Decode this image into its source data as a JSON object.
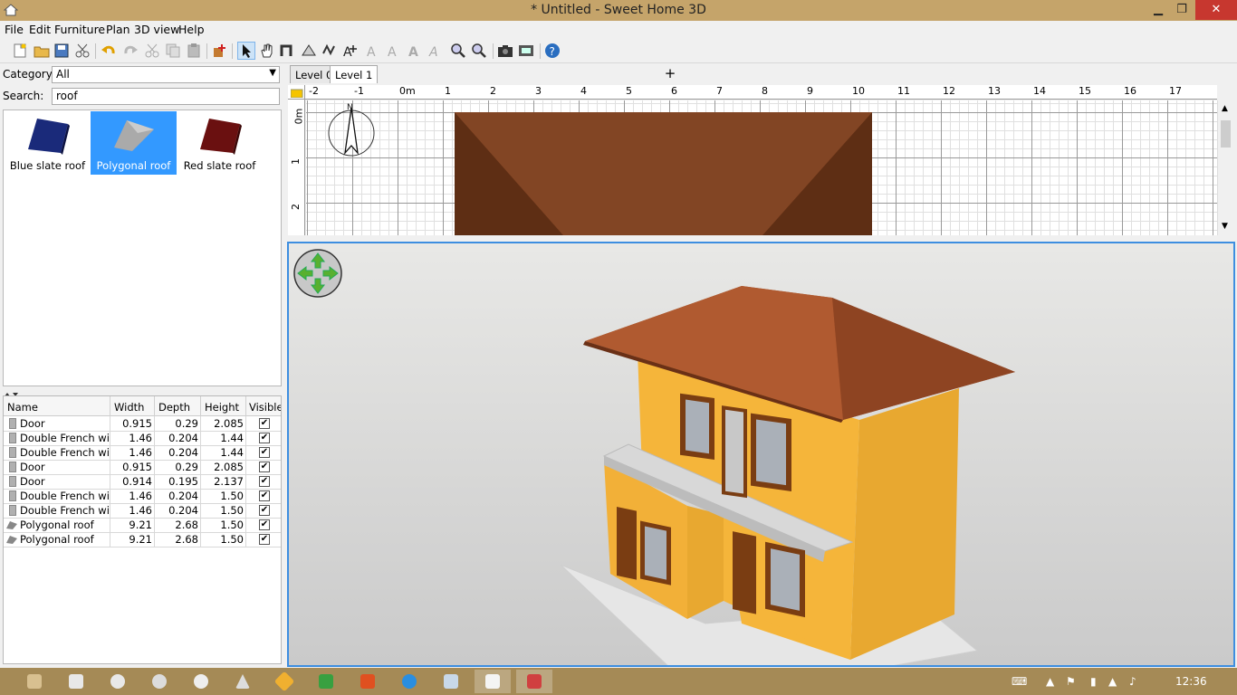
{
  "window": {
    "title": "* Untitled - Sweet Home 3D",
    "min": "▁",
    "max": "❐",
    "close": "✕"
  },
  "menu": [
    "File",
    "Edit",
    "Furniture",
    "Plan",
    "3D view",
    "Help"
  ],
  "toolbar": {
    "icons": [
      "new-home-icon",
      "open-icon",
      "save-icon",
      "cut-icon",
      "undo-icon",
      "redo-icon",
      "cut2-icon",
      "copy-icon",
      "paste-icon",
      "add-furniture-icon",
      "select-mode-icon",
      "pan-mode-icon",
      "create-walls-icon",
      "create-rooms-icon",
      "create-polylines-icon",
      "create-dimensions-icon",
      "add-text-icon",
      "increase-text-icon",
      "decrease-text-icon",
      "bold-text-icon",
      "zoom-in-icon",
      "zoom-out-icon",
      "create-photo-icon",
      "create-video-icon",
      "help-icon"
    ]
  },
  "catalog": {
    "category_label": "Category:",
    "category_value": "All",
    "search_label": "Search:",
    "search_value": "roof",
    "items": [
      {
        "label": "Blue slate roof",
        "color": "#1a2a7a",
        "selected": false
      },
      {
        "label": "Polygonal roof",
        "color": "#9a9a9a",
        "selected": true
      },
      {
        "label": "Red slate roof",
        "color": "#6a1010",
        "selected": false
      }
    ]
  },
  "furniture": {
    "headers": {
      "name": "Name",
      "width": "Width",
      "depth": "Depth",
      "height": "Height",
      "visible": "Visible"
    },
    "rows": [
      {
        "name": "Door",
        "width": "0.915",
        "depth": "0.29",
        "height": "2.085",
        "visible": "✔"
      },
      {
        "name": "Double French wi...",
        "width": "1.46",
        "depth": "0.204",
        "height": "1.44",
        "visible": "✔"
      },
      {
        "name": "Double French wi...",
        "width": "1.46",
        "depth": "0.204",
        "height": "1.44",
        "visible": "✔"
      },
      {
        "name": "Door",
        "width": "0.915",
        "depth": "0.29",
        "height": "2.085",
        "visible": "✔"
      },
      {
        "name": "Door",
        "width": "0.914",
        "depth": "0.195",
        "height": "2.137",
        "visible": "✔"
      },
      {
        "name": "Double French wi...",
        "width": "1.46",
        "depth": "0.204",
        "height": "1.50",
        "visible": "✔"
      },
      {
        "name": "Double French wi...",
        "width": "1.46",
        "depth": "0.204",
        "height": "1.50",
        "visible": "✔"
      },
      {
        "name": "Polygonal roof",
        "width": "9.21",
        "depth": "2.68",
        "height": "1.50",
        "visible": "✔"
      },
      {
        "name": "Polygonal roof",
        "width": "9.21",
        "depth": "2.68",
        "height": "1.50",
        "visible": "✔"
      }
    ]
  },
  "plan": {
    "tabs": [
      "Level 0",
      "Level 1"
    ],
    "active_tab": "Level 1",
    "add_tab": "+",
    "ruler_x": [
      "-2",
      "-1",
      "0m",
      "1",
      "2",
      "3",
      "4",
      "5",
      "6",
      "7",
      "8",
      "9",
      "10",
      "11",
      "12",
      "13",
      "14",
      "15",
      "16",
      "17"
    ],
    "ruler_y": [
      "0m",
      "1",
      "2"
    ],
    "compass_n": "N",
    "roof_color": "#7a3f20"
  },
  "view3d": {
    "roof_color": "#a0502a",
    "wall_color": "#f5b53a",
    "window_color": "#7a3d12"
  },
  "taskbar": {
    "apps": [
      "explorer",
      "files",
      "ie",
      "chrome-like",
      "app5",
      "app6",
      "app7",
      "app8",
      "app9",
      "app10",
      "app11",
      "sweet-home-3d",
      "app13"
    ],
    "clock": "12:36"
  }
}
